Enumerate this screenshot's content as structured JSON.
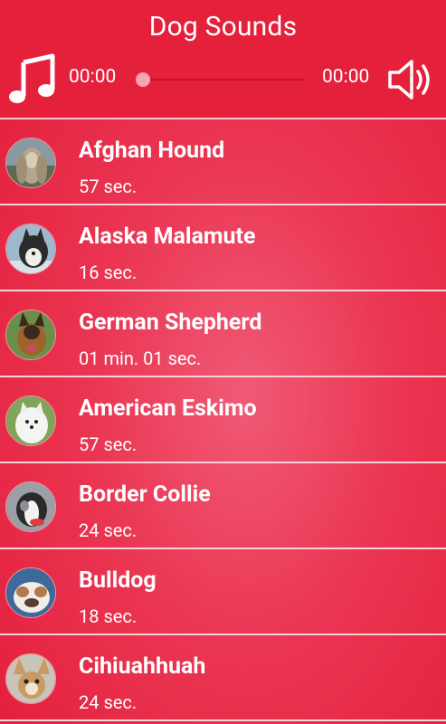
{
  "app": {
    "title": "Dog Sounds"
  },
  "player": {
    "current_time": "00:00",
    "total_time": "00:00",
    "progress": 0,
    "music_icon": "music-note-icon",
    "volume_icon": "speaker-volume-icon"
  },
  "colors": {
    "background": "#e4203b",
    "divider": "#f3d3d8",
    "text": "#ffffff",
    "seek_thumb": "#f7a3b1"
  },
  "sounds": [
    {
      "name": "Afghan Hound",
      "duration": "57 sec."
    },
    {
      "name": "Alaska Malamute",
      "duration": "16 sec."
    },
    {
      "name": "German Shepherd",
      "duration": "01 min. 01 sec."
    },
    {
      "name": "American Eskimo",
      "duration": "57 sec."
    },
    {
      "name": "Border Collie",
      "duration": "24 sec."
    },
    {
      "name": "Bulldog",
      "duration": "18 sec."
    },
    {
      "name": "Cihiuahhuah",
      "duration": "24 sec."
    }
  ]
}
